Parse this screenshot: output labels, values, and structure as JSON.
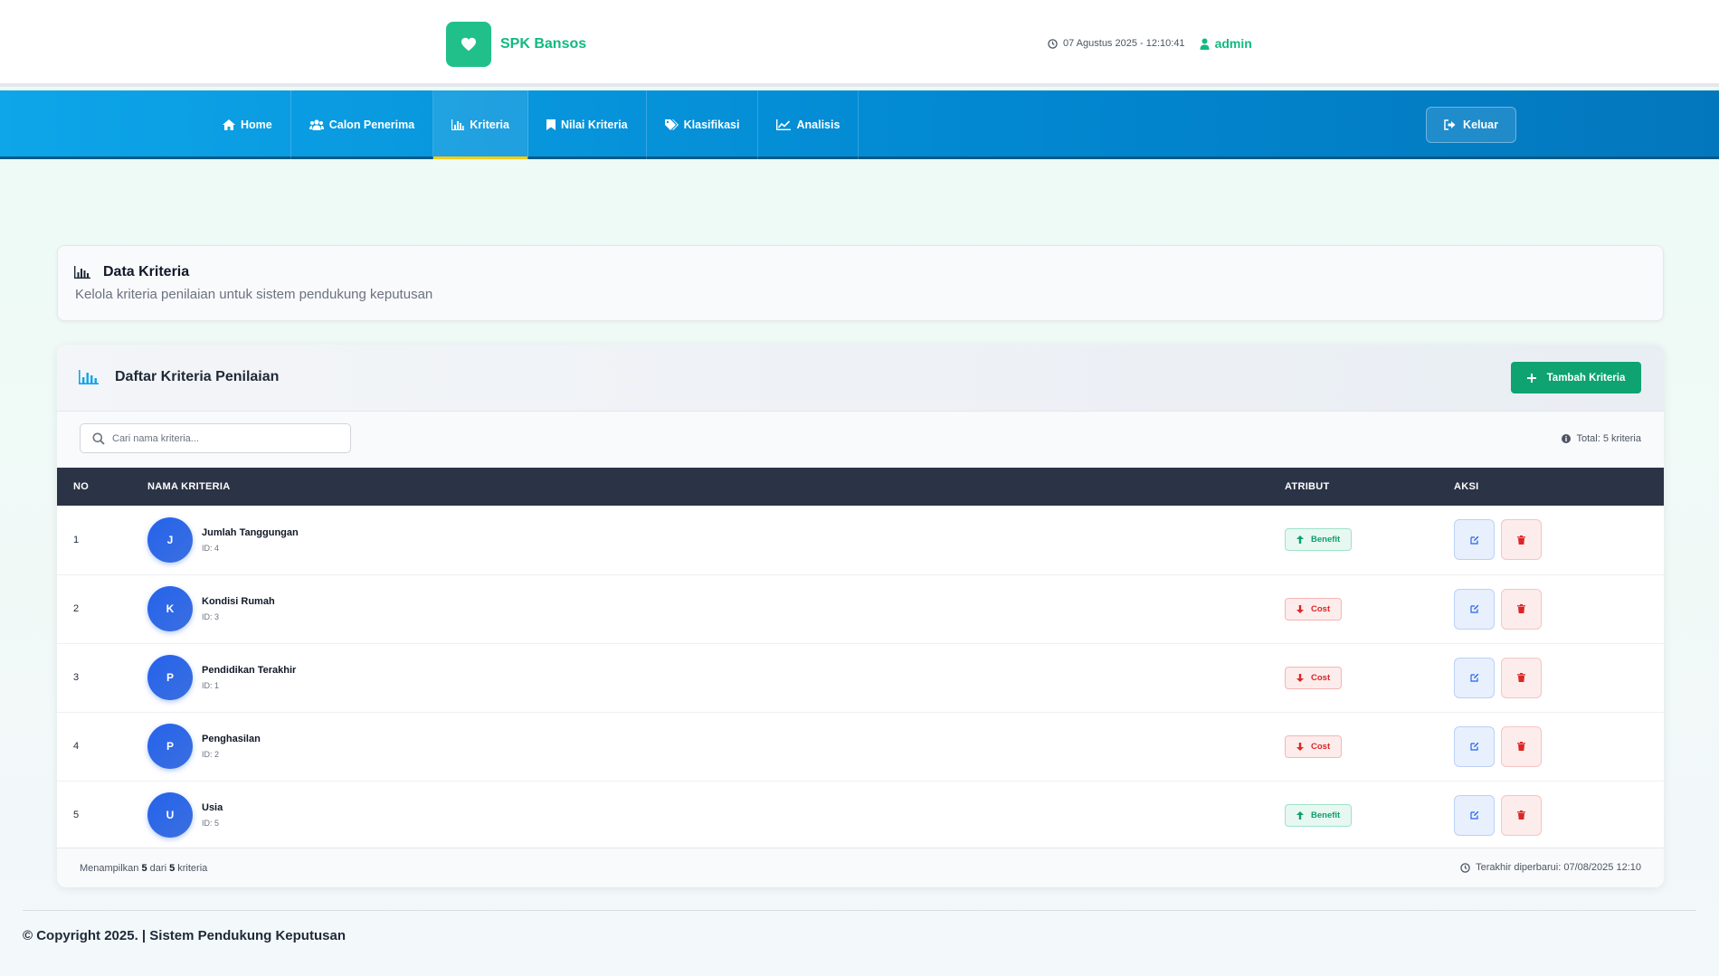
{
  "brand": {
    "name": "SPK Bansos",
    "logo_icon": "heart-icon",
    "accent": "#21c08b"
  },
  "header": {
    "datetime": "07 Agustus 2025 - 12:10:41",
    "user": "admin"
  },
  "nav": {
    "items": [
      {
        "label": "Home",
        "icon": "home-icon"
      },
      {
        "label": "Calon Penerima",
        "icon": "users-icon"
      },
      {
        "label": "Kriteria",
        "icon": "bar-chart-icon",
        "active": true
      },
      {
        "label": "Nilai Kriteria",
        "icon": "bookmark-icon"
      },
      {
        "label": "Klasifikasi",
        "icon": "tags-icon"
      },
      {
        "label": "Analisis",
        "icon": "line-chart-icon"
      }
    ],
    "logout_label": "Keluar"
  },
  "page": {
    "title": "Data Kriteria",
    "subtitle": "Kelola kriteria penilaian untuk sistem pendukung keputusan"
  },
  "card": {
    "title": "Daftar Kriteria Penilaian",
    "add_button": "Tambah Kriteria",
    "search_placeholder": "Cari nama kriteria...",
    "total": "Total: 5 kriteria"
  },
  "table": {
    "headers": {
      "no": "NO",
      "nama": "NAMA KRITERIA",
      "atribut": "ATRIBUT",
      "aksi": "AKSI"
    },
    "rows": [
      {
        "no": "1",
        "initial": "J",
        "name": "Jumlah Tanggungan",
        "id": "ID: 4",
        "attribute": "Benefit"
      },
      {
        "no": "2",
        "initial": "K",
        "name": "Kondisi Rumah",
        "id": "ID: 3",
        "attribute": "Cost"
      },
      {
        "no": "3",
        "initial": "P",
        "name": "Pendidikan Terakhir",
        "id": "ID: 1",
        "attribute": "Cost"
      },
      {
        "no": "4",
        "initial": "P",
        "name": "Penghasilan",
        "id": "ID: 2",
        "attribute": "Cost"
      },
      {
        "no": "5",
        "initial": "U",
        "name": "Usia",
        "id": "ID: 5",
        "attribute": "Benefit"
      }
    ]
  },
  "footer_info": {
    "showing_prefix": "Menampilkan",
    "shown": "5",
    "of": "dari",
    "total": "5",
    "suffix": "kriteria",
    "updated": "Terakhir diperbarui: 07/08/2025 12:10"
  },
  "copyright": "© Copyright 2025. | Sistem Pendukung Keputusan",
  "colors": {
    "nav_start": "#0ea5e9",
    "nav_end": "#0377bd",
    "table_head": "#2b3446",
    "benefit": "#0e9f6e",
    "cost": "#dc2626"
  }
}
